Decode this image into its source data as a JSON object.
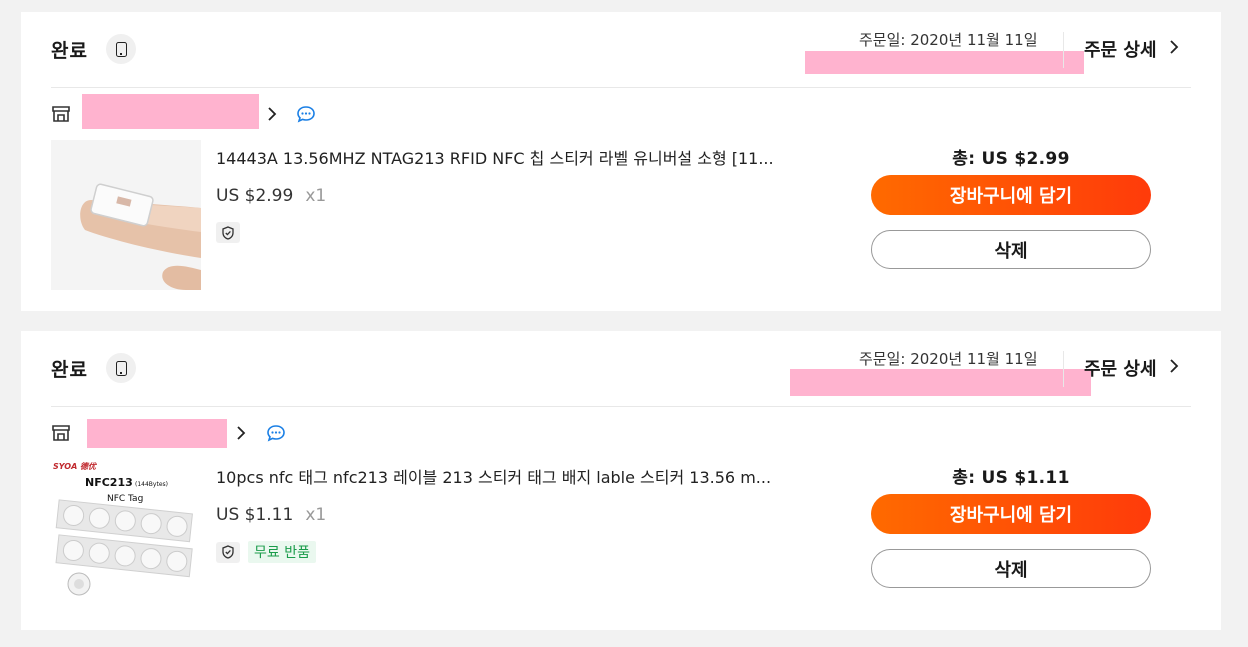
{
  "orders": [
    {
      "status": "완료",
      "order_date": "주문일: 2020년 11월 11일",
      "detail_label": "주문 상세",
      "product": {
        "title": "14443A 13.56MHZ NTAG213 RFID NFC 칩 스티커 라벨 유니버설 소형 [11...",
        "price": "US $2.99",
        "qty": "x1"
      },
      "total": "총: US $2.99",
      "cart_button": "장바구니에 담기",
      "delete_button": "삭제"
    },
    {
      "status": "완료",
      "order_date": "주문일: 2020년 11월 11일",
      "detail_label": "주문 상세",
      "product": {
        "title": "10pcs nfc 태그 nfc213 레이블 213 스티커 태그 배지 lable 스티커 13.56 m...",
        "price": "US $1.11",
        "qty": "x1",
        "free_return": "무료 반품",
        "image_text": {
          "brand": "SYOA 德优",
          "model": "NFC213",
          "bytes": "(144Bytes)",
          "tag": "NFC Tag"
        }
      },
      "total": "총: US $1.11",
      "cart_button": "장바구니에 담기",
      "delete_button": "삭제"
    }
  ],
  "colors": {
    "accent_start": "#ff6a00",
    "accent_end": "#ff3b0a",
    "redaction": "#ffb3cf",
    "free_return_text": "#1a9c4a",
    "chat_icon": "#1a7fe5"
  },
  "icons": [
    "device-icon",
    "store-icon",
    "chevron-right-icon",
    "chat-icon",
    "shield-icon"
  ]
}
